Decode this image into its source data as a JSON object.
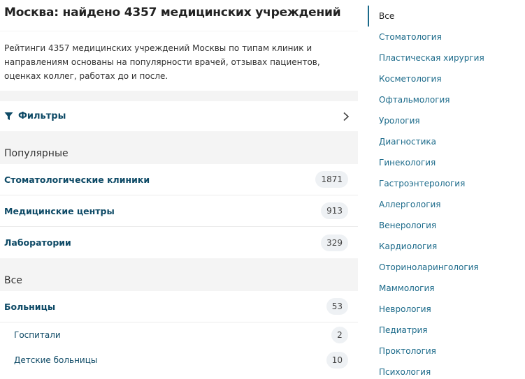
{
  "page_title": "Москва: найдено 4357 медицинских учреждений",
  "intro_text": "Рейтинги 4357 медицинских учреждений Москвы по типам клиник и направлениям основаны на популярности врачей, отзывах пациентов, оценках коллег, работах до и после.",
  "filters": {
    "label": "Фильтры"
  },
  "popular": {
    "heading": "Популярные",
    "items": [
      {
        "label": "Стоматологические клиники",
        "count": "1871"
      },
      {
        "label": "Медицинские центры",
        "count": "913"
      },
      {
        "label": "Лаборатории",
        "count": "329"
      }
    ]
  },
  "all": {
    "heading": "Все",
    "items": [
      {
        "label": "Больницы",
        "count": "53"
      },
      {
        "label": "Госпитали",
        "count": "2"
      },
      {
        "label": "Детские больницы",
        "count": "10"
      }
    ]
  },
  "sidebar": {
    "items": [
      {
        "label": "Все"
      },
      {
        "label": "Стоматология"
      },
      {
        "label": "Пластическая хирургия"
      },
      {
        "label": "Косметология"
      },
      {
        "label": "Офтальмология"
      },
      {
        "label": "Урология"
      },
      {
        "label": "Диагностика"
      },
      {
        "label": "Гинекология"
      },
      {
        "label": "Гастроэнтерология"
      },
      {
        "label": "Аллергология"
      },
      {
        "label": "Венерология"
      },
      {
        "label": "Кардиология"
      },
      {
        "label": "Оториноларингология"
      },
      {
        "label": "Маммология"
      },
      {
        "label": "Неврология"
      },
      {
        "label": "Педиатрия"
      },
      {
        "label": "Проктология"
      },
      {
        "label": "Психология"
      }
    ]
  },
  "colors": {
    "link": "#0e4a66",
    "sidebar_link": "#1b6a8a",
    "background": "#f4f4f4"
  }
}
